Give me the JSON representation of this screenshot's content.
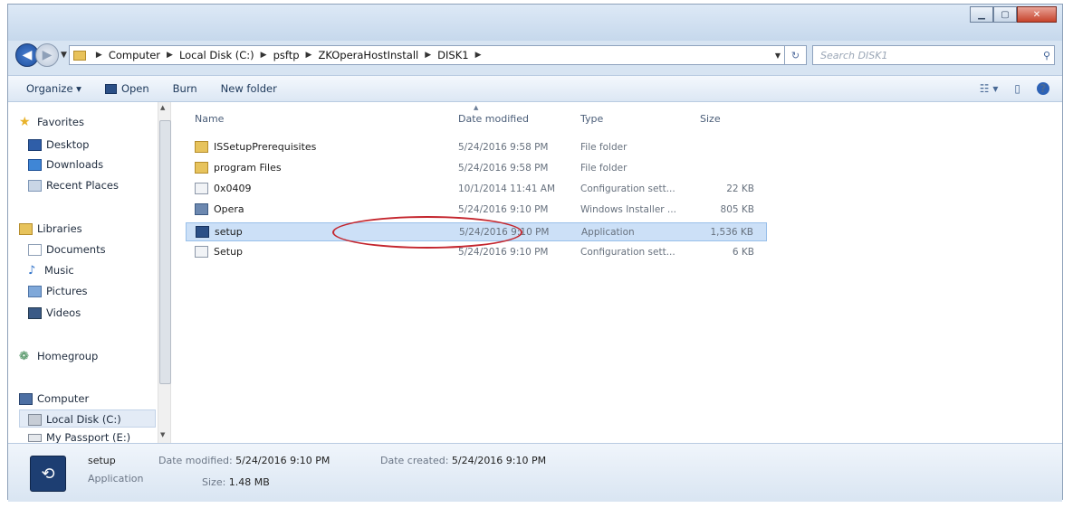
{
  "nav": {
    "breadcrumbs": [
      "Computer",
      "Local Disk (C:)",
      "psftp",
      "ZKOperaHostInstall",
      "DISK1"
    ],
    "search_placeholder": "Search DISK1"
  },
  "toolbar": {
    "organize": "Organize ▾",
    "open": "Open",
    "burn": "Burn",
    "new_folder": "New folder"
  },
  "sidebar": {
    "favorites": "Favorites",
    "desktop": "Desktop",
    "downloads": "Downloads",
    "recent": "Recent Places",
    "libraries": "Libraries",
    "documents": "Documents",
    "music": "Music",
    "pictures": "Pictures",
    "videos": "Videos",
    "homegroup": "Homegroup",
    "computer": "Computer",
    "local_disk": "Local Disk (C:)",
    "my_passport": "My Passport (E:)"
  },
  "columns": {
    "name": "Name",
    "date": "Date modified",
    "type": "Type",
    "size": "Size"
  },
  "files": [
    {
      "name": "ISSetupPrerequisites",
      "date": "5/24/2016 9:58 PM",
      "type": "File folder",
      "size": "",
      "icon": "folder-icon"
    },
    {
      "name": "program Files",
      "date": "5/24/2016 9:58 PM",
      "type": "File folder",
      "size": "",
      "icon": "folder-icon"
    },
    {
      "name": "0x0409",
      "date": "10/1/2014 11:41 AM",
      "type": "Configuration sett...",
      "size": "22 KB",
      "icon": "config-file-icon"
    },
    {
      "name": "Opera",
      "date": "5/24/2016 9:10 PM",
      "type": "Windows Installer ...",
      "size": "805 KB",
      "icon": "installer-icon"
    },
    {
      "name": "setup",
      "date": "5/24/2016 9:10 PM",
      "type": "Application",
      "size": "1,536 KB",
      "icon": "application-icon"
    },
    {
      "name": "Setup",
      "date": "5/24/2016 9:10 PM",
      "type": "Configuration sett...",
      "size": "6 KB",
      "icon": "config-file-icon"
    }
  ],
  "details": {
    "name": "setup",
    "kind": "Application",
    "modified_label": "Date modified:",
    "modified_value": "5/24/2016 9:10 PM",
    "size_label": "Size:",
    "size_value": "1.48 MB",
    "created_label": "Date created:",
    "created_value": "5/24/2016 9:10 PM"
  },
  "colors": {
    "selection": "#cce0f7",
    "highlight_oval": "#c4262e",
    "chrome": "#d7e4f2"
  }
}
